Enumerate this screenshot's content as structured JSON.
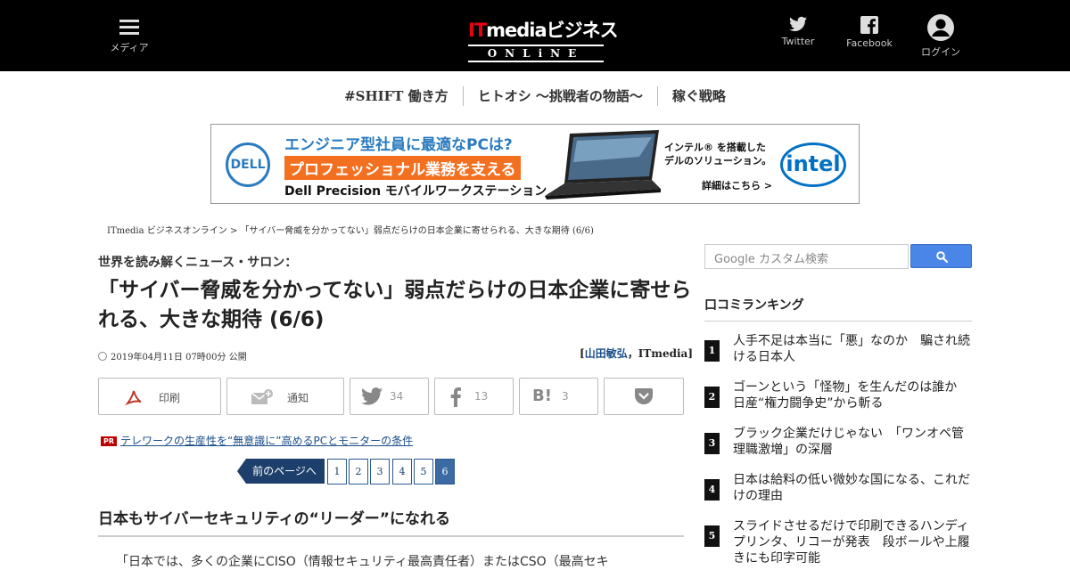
{
  "header": {
    "menu_label": "メディア",
    "logo_top_it": "IT",
    "logo_top_rest": "mediaビジネス",
    "logo_bottom": "ONLiNE",
    "twitter_label": "Twitter",
    "facebook_label": "Facebook",
    "login_label": "ログイン"
  },
  "subnav": {
    "items": [
      "#SHIFT 働き方",
      "ヒトオシ ～挑戦者の物語～",
      "稼ぐ戦略"
    ]
  },
  "ad": {
    "brand": "DELL",
    "headline": "エンジニア型社員に最適なPCは?",
    "orange": "プロフェッショナル業務を支える",
    "sub": "Dell Precision モバイルワークステーション",
    "right_line1": "インテル® を搭載した",
    "right_line2": "デルのソリューション。",
    "more": "詳細はこちら >",
    "intel": "intel"
  },
  "breadcrumb": "ITmedia ビジネスオンライン > 「サイバー脅威を分かってない」弱点だらけの日本企業に寄せられる、大きな期待 (6/6)",
  "article": {
    "kicker": "世界を読み解くニュース・サロン：",
    "title": "「サイバー脅威を分かってない」弱点だらけの日本企業に寄せられる、大きな期待 (6/6)",
    "date": "2019年04月11日 07時00分 公開",
    "author_open": "[",
    "author_name": "山田敏弘",
    "author_rest": "，ITmedia]",
    "section_heading": "日本もサイバーセキュリティの“リーダー”になれる",
    "body_first": "「日本では、多くの企業にCISO（情報セキュリティ最高責任者）またはCSO（最高セキ"
  },
  "share": {
    "print": "印刷",
    "notify": "通知",
    "twitter_count": "34",
    "facebook_count": "13",
    "hatena_count": "3"
  },
  "pr": {
    "badge": "PR",
    "link": "テレワークの生産性を“無意識に”高めるPCとモニターの条件"
  },
  "pager": {
    "prev": "前のページへ",
    "pages": [
      "1",
      "2",
      "3",
      "4",
      "5",
      "6"
    ],
    "current": "6"
  },
  "sidebar": {
    "search_placeholder": "Google カスタム検索",
    "ranking_title": "口コミランキング",
    "ranking": [
      {
        "num": "1",
        "text": "人手不足は本当に「悪」なのか　騙され続ける日本人"
      },
      {
        "num": "2",
        "text": "ゴーンという「怪物」を生んだのは誰か　日産“権力闘争史”から斬る"
      },
      {
        "num": "3",
        "text": "ブラック企業だけじゃない　「ワンオペ管理職激増」の深層"
      },
      {
        "num": "4",
        "text": "日本は給料の低い微妙な国になる、これだけの理由"
      },
      {
        "num": "5",
        "text": "スライドさせるだけで印刷できるハンディプリンタ、リコーが発表　段ボールや上履きにも印字可能"
      }
    ]
  },
  "colors": {
    "topbar": "#000000",
    "accent_blue": "#1d3f6b",
    "link": "#1a4e8a",
    "dell_blue": "#2a7bbf",
    "ad_orange": "#f37021",
    "intel_blue": "#0071c5"
  }
}
